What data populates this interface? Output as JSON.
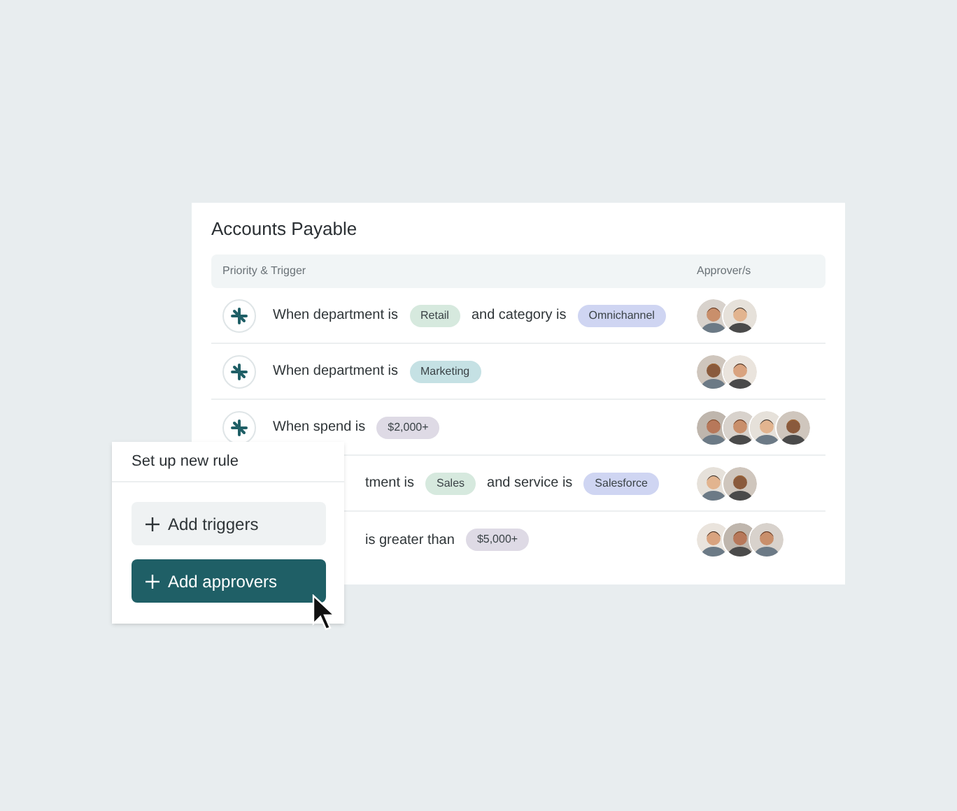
{
  "card": {
    "title": "Accounts Payable",
    "columns": [
      "Priority & Trigger",
      "Approver/s"
    ],
    "rows": [
      {
        "icon_visible": true,
        "segments": [
          {
            "kind": "text",
            "text": "When department is"
          },
          {
            "kind": "tag",
            "text": "Retail",
            "color": "#d6e9de"
          },
          {
            "kind": "text",
            "text": "and category is"
          },
          {
            "kind": "tag",
            "text": "Omnichannel",
            "color": "#cfd5f2"
          }
        ],
        "approvers": [
          {
            "kind": "picture"
          },
          {
            "kind": "picture"
          }
        ]
      },
      {
        "icon_visible": true,
        "segments": [
          {
            "kind": "text",
            "text": "When department is"
          },
          {
            "kind": "tag",
            "text": "Marketing",
            "color": "#c5e1e4"
          }
        ],
        "approvers": [
          {
            "kind": "picture"
          },
          {
            "kind": "picture"
          }
        ]
      },
      {
        "icon_visible": true,
        "segments": [
          {
            "kind": "text",
            "text": "When spend is"
          },
          {
            "kind": "tag",
            "text": "$2,000+",
            "color": "#dedae5"
          }
        ],
        "approvers": [
          {
            "kind": "picture"
          },
          {
            "kind": "picture"
          },
          {
            "kind": "picture"
          },
          {
            "kind": "picture"
          }
        ]
      },
      {
        "icon_visible": false,
        "segments": [
          {
            "kind": "text",
            "text": "tment is"
          },
          {
            "kind": "tag",
            "text": "Sales",
            "color": "#d6e9de"
          },
          {
            "kind": "text",
            "text": "and service is"
          },
          {
            "kind": "tag",
            "text": "Salesforce",
            "color": "#cfd5f2"
          }
        ],
        "approvers": [
          {
            "kind": "picture"
          },
          {
            "kind": "picture"
          }
        ]
      },
      {
        "icon_visible": false,
        "segments": [
          {
            "kind": "text",
            "text": "is greater than"
          },
          {
            "kind": "tag",
            "text": "$5,000+",
            "color": "#dedae5"
          }
        ],
        "approvers": [
          {
            "kind": "picture"
          },
          {
            "kind": "picture"
          },
          {
            "kind": "picture"
          }
        ]
      }
    ]
  },
  "rule_panel": {
    "title": "Set up new rule",
    "buttons": [
      {
        "kind": "secondary",
        "label": "Add triggers"
      },
      {
        "kind": "primary",
        "label": "Add approvers"
      }
    ]
  }
}
